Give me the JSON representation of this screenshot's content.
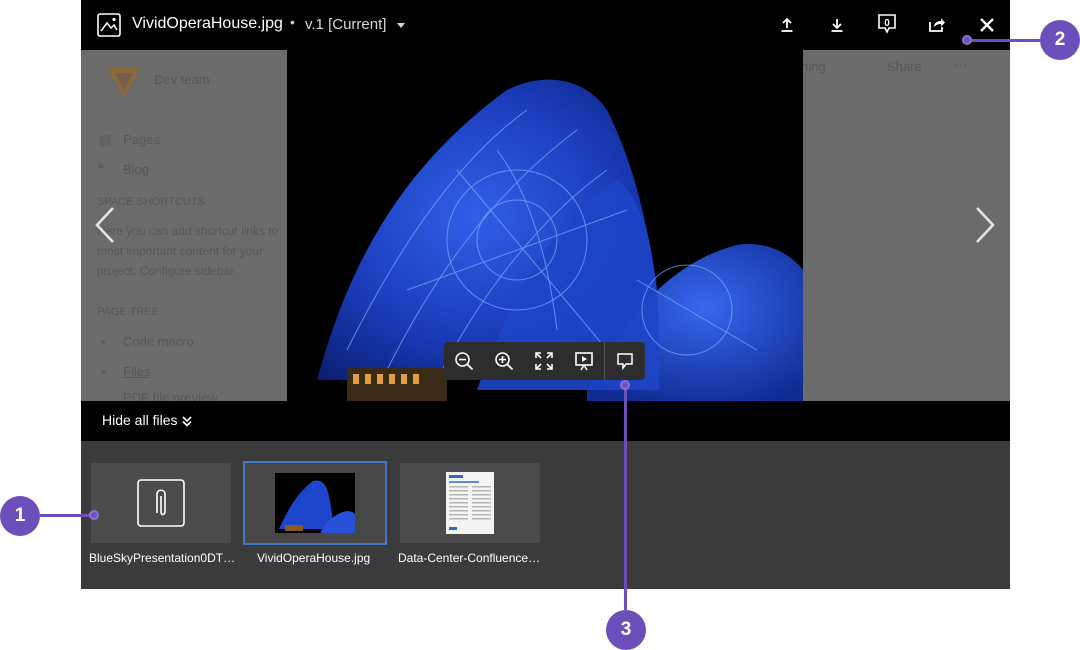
{
  "header": {
    "filename": "VividOperaHouse.jpg",
    "separator": "•",
    "version": "v.1 [Current]",
    "comment_count": "0",
    "buttons": [
      "upload-icon",
      "download-icon",
      "comment-icon",
      "share-icon",
      "close-icon"
    ]
  },
  "background_page": {
    "space_name": "Dev team",
    "watching": "tching",
    "share": "Share",
    "more": "···",
    "nav_pages": "Pages",
    "nav_blog": "Blog",
    "shortcuts_heading": "SPACE SHORTCUTS",
    "shortcuts_line1": "Here you can add shortcut links to",
    "shortcuts_line2": "most important content for your",
    "shortcuts_line3": "project. Configure sidebar.",
    "tree_heading": "PAGE TREE",
    "tree_item1": "Code macro",
    "tree_item2": "Files",
    "tree_item3": "PDF file preview"
  },
  "strip": {
    "toggle_label": "Hide all files",
    "files": [
      {
        "name": "BlueSkyPresentation0DT…",
        "kind": "attachment"
      },
      {
        "name": "VividOperaHouse.jpg",
        "kind": "image",
        "selected": true
      },
      {
        "name": "Data-Center-Confluence…",
        "kind": "document"
      }
    ]
  },
  "zoom_toolbar": [
    "zoom-out-icon",
    "zoom-in-icon",
    "fullscreen-icon",
    "presentation-icon",
    "comment-icon"
  ],
  "callouts": [
    "1",
    "2",
    "3"
  ],
  "colors": {
    "header_bg": "#000000",
    "viewer_bg": "#3b3b3b",
    "selection_border": "#3f79c7",
    "callout": "#6b4fbb"
  }
}
